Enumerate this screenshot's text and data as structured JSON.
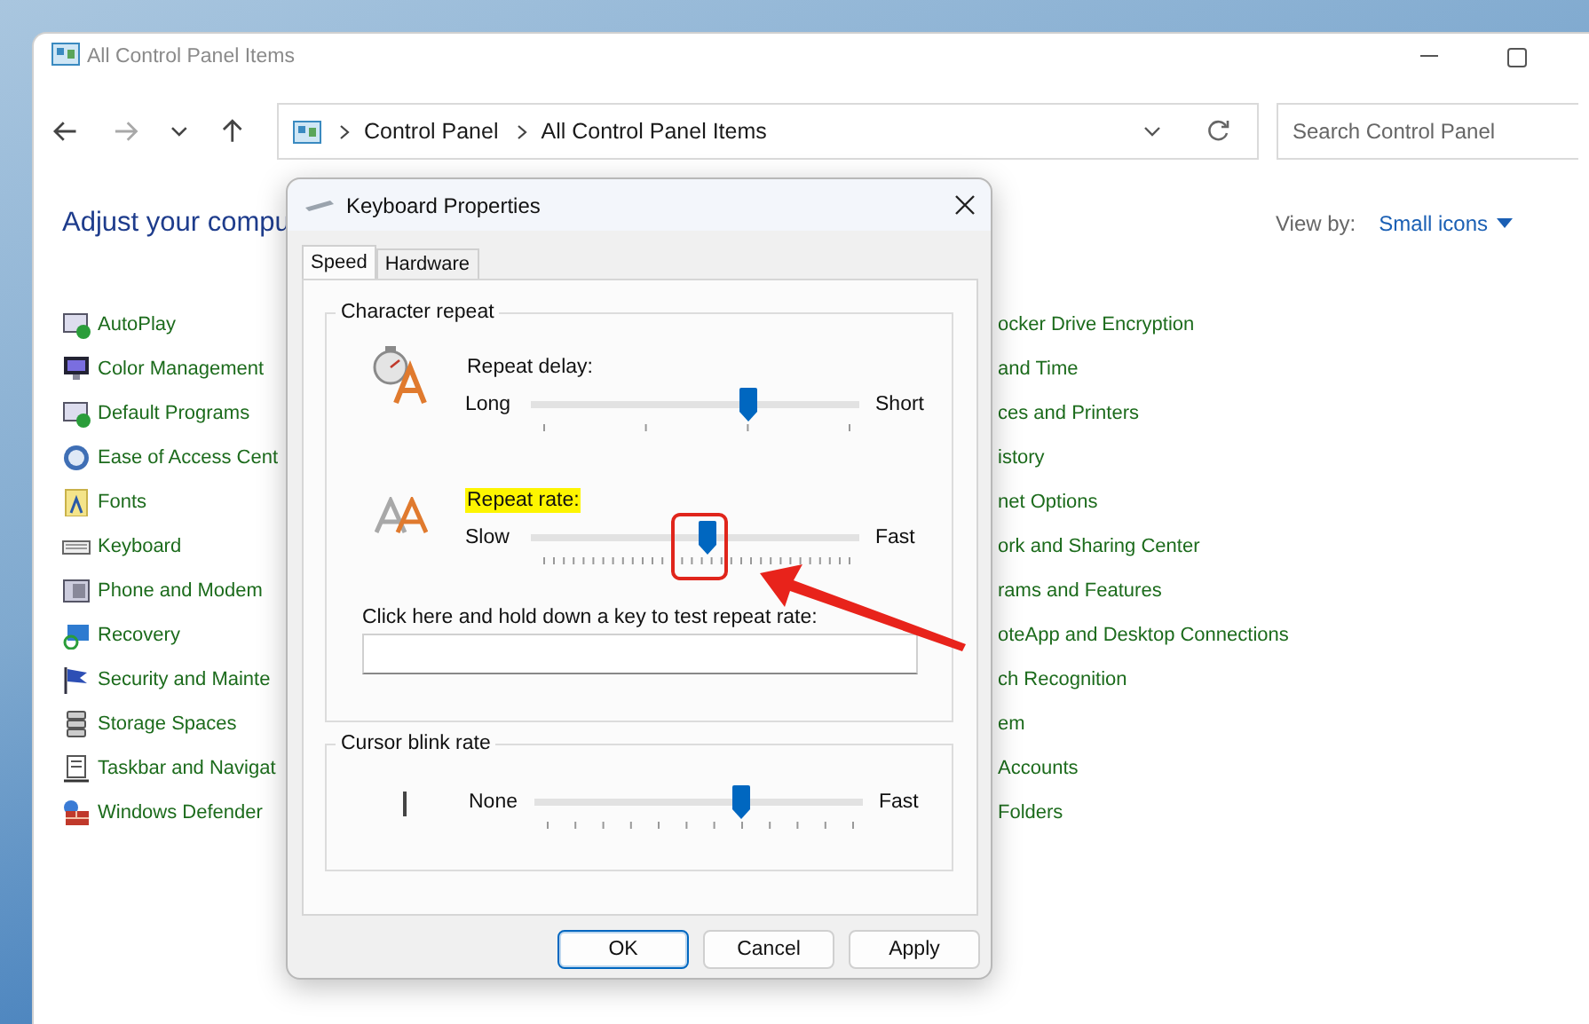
{
  "window": {
    "title": "All Control Panel Items"
  },
  "nav_buttons": [
    {
      "kind": "back",
      "disabled": false
    },
    {
      "kind": "forward",
      "disabled": true
    },
    {
      "kind": "recent",
      "disabled": false
    },
    {
      "kind": "up",
      "disabled": false
    }
  ],
  "address_bar": {
    "path": [
      "Control Panel",
      "All Control Panel Items"
    ]
  },
  "search": {
    "placeholder": "Search Control Panel"
  },
  "heading": "Adjust your compu",
  "view_by": {
    "label": "View by:",
    "value": "Small icons"
  },
  "items_left": [
    {
      "label": "AutoPlay"
    },
    {
      "label": "Color Management"
    },
    {
      "label": "Default Programs"
    },
    {
      "label": "Ease of Access Cent"
    },
    {
      "label": "Fonts"
    },
    {
      "label": "Keyboard"
    },
    {
      "label": "Phone and Modem"
    },
    {
      "label": "Recovery"
    },
    {
      "label": "Security and Mainte"
    },
    {
      "label": "Storage Spaces"
    },
    {
      "label": "Taskbar and Navigat"
    },
    {
      "label": "Windows Defender"
    }
  ],
  "items_right": [
    {
      "label": "ocker Drive Encryption"
    },
    {
      "label": "and Time"
    },
    {
      "label": "ces and Printers"
    },
    {
      "label": "istory"
    },
    {
      "label": "net Options"
    },
    {
      "label": "ork and Sharing Center"
    },
    {
      "label": "rams and Features"
    },
    {
      "label": "oteApp and Desktop Connections"
    },
    {
      "label": "ch Recognition"
    },
    {
      "label": "em"
    },
    {
      "label": "Accounts"
    },
    {
      "label": "Folders"
    }
  ],
  "dialog": {
    "title": "Keyboard Properties",
    "tabs": [
      {
        "label": "Speed",
        "selected": true
      },
      {
        "label": "Hardware",
        "selected": false
      }
    ],
    "groups": [
      {
        "title": "Character repeat",
        "settings": [
          {
            "kind": "delay",
            "label": "Repeat delay:",
            "highlighted": false,
            "min_label": "Long",
            "max_label": "Short",
            "level": 0.66
          },
          {
            "kind": "rate",
            "label": "Repeat rate:",
            "highlighted": true,
            "min_label": "Slow",
            "max_label": "Fast",
            "level": 0.54
          }
        ],
        "test": {
          "label": "Click here and hold down a key to test repeat rate:"
        }
      },
      {
        "title": "Cursor blink rate",
        "settings": [
          {
            "kind": "blink",
            "min_label": "None",
            "max_label": "Fast",
            "level": 0.63
          }
        ]
      }
    ],
    "buttons": [
      {
        "label": "OK",
        "default": true
      },
      {
        "label": "Cancel",
        "default": false
      },
      {
        "label": "Apply",
        "default": false
      }
    ]
  },
  "annotations": {
    "frame": true,
    "arrow": true
  }
}
